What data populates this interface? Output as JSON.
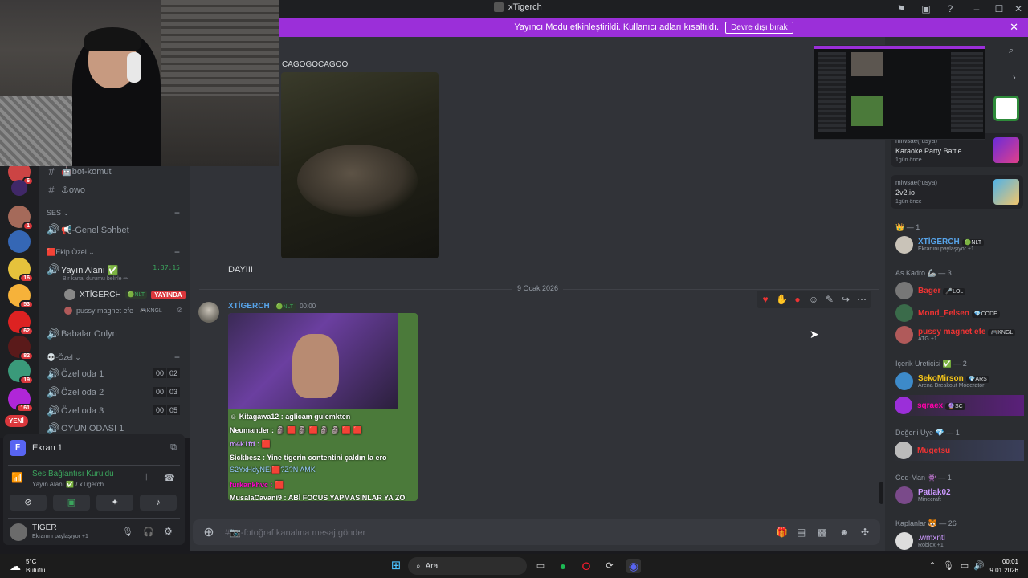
{
  "window": {
    "title": "xTigerch"
  },
  "banner": {
    "text": "Yayıncı Modu etkinleştirildi. Kullanıcı adları kısaltıldı.",
    "button": "Devre dışı bırak"
  },
  "servers": [
    {
      "badge": "6"
    },
    {
      "badge": ""
    },
    {
      "badge": "1"
    },
    {
      "badge": ""
    },
    {
      "badge": "16"
    },
    {
      "badge": "53"
    },
    {
      "badge": "62"
    },
    {
      "badge": "82"
    },
    {
      "badge": "19"
    },
    {
      "badge": "161"
    }
  ],
  "server_new": "YENİ",
  "channels": {
    "text": [
      {
        "name": "🤖bot-komut"
      },
      {
        "name": "⚓owo"
      }
    ],
    "voice_category": "SES",
    "voice": [
      {
        "name": "📢-Genel Sohbet"
      }
    ],
    "ekip_category": "🟥Ekip Özel",
    "stream_channel": {
      "name": "Yayın Alanı ✅",
      "time": "1:37:15",
      "status": "Bir kanal durumu belirle ✏"
    },
    "stream_users": [
      {
        "name": "XTİGERCH",
        "tag": "🟢NLT",
        "live": "YAYINDA"
      },
      {
        "name": "pussy magnet efe",
        "tag": "🎮KNGL"
      }
    ],
    "babalar": "Babalar Onlyn",
    "ozel_category": "💀-Özel",
    "ozel_rooms": [
      {
        "name": "Özel oda 1",
        "a": "00",
        "b": "02"
      },
      {
        "name": "Özel oda 2",
        "a": "00",
        "b": "03"
      },
      {
        "name": "Özel oda 3",
        "a": "00",
        "b": "05"
      },
      {
        "name": "OYUN ODASI 1",
        "a": "",
        "b": ""
      }
    ]
  },
  "screen_panel": {
    "title": "Ekran 1",
    "icon_letter": "F",
    "conn_status": "Ses Bağlantısı Kuruldu",
    "conn_sub": "Yayın Alanı ✅ / xTigerch",
    "user": "TIGER",
    "user_status": "Ekranını paylaşıyor +1"
  },
  "chat": {
    "msg1_name": "CAGOGOCAGOO",
    "msg1_text": "DAYIII",
    "date_divider": "9 Ocak 2026",
    "msg2_name": "XTİGERCH",
    "msg2_tag": "🟢NLT",
    "msg2_time": "00:00",
    "stream_chat": [
      "☺ Kitagawa12 : aglicam gulemkten",
      "Neumander : 🗿 🟥 🗿 🟥 🗿 🗿 🟥 🟥",
      "m4k1fd : 🟥",
      "Sickbesz : Yine tigerin contentini çaldın la ero",
      "S2YxHdyNEl🟥?Z?N AMK",
      "furkankhvc : 🟥",
      "MusalaCavani9 : ABİ FOCUS YAPMASINLAR YA ZO"
    ],
    "composer_placeholder": "#📷-fotoğraf kanalına mesaj gönder"
  },
  "activities": [
    {
      "name": "miwsae(rusya)",
      "title": "Karaoke Party Battle",
      "sub": "1gün önce"
    },
    {
      "name": "miwsae(rusya)",
      "title": "2v2.io",
      "sub": "1gün önce"
    }
  ],
  "members": {
    "cat1": "👑 — 1",
    "m1": {
      "name": "XTİGERCH",
      "tag": "🟢NLT",
      "sub": "Ekranını paylaşıyor +1"
    },
    "cat2": "As Kadro 🦾 — 3",
    "m2": {
      "name": "Bager",
      "tag": "🎤LOL"
    },
    "m3": {
      "name": "Mond_Felsen",
      "tag": "💎CODE"
    },
    "m4": {
      "name": "pussy magnet efe",
      "tag": "🎮KNGL",
      "sub": "ATG +1"
    },
    "cat3": "İçerik Üreticisi ✅ — 2",
    "m5": {
      "name": "SekoMirson",
      "tag": "💎ARS",
      "sub": "Arena Breakout Moderator"
    },
    "m6": {
      "name": "sqraex",
      "tag": "🔮SC"
    },
    "cat4": "Değerli Üye 💎 — 1",
    "m7": {
      "name": "Mugetsu"
    },
    "cat5": "Cod-Man 👾 — 1",
    "m8": {
      "name": "Patlak02",
      "sub": "Minecraft"
    },
    "cat6": "Kaplanlar 🐯 — 26",
    "m9": {
      "name": ".wmxntl",
      "sub": "Roblox +1"
    }
  },
  "taskbar": {
    "weather_temp": "5°C",
    "weather_desc": "Bulutlu",
    "search": "Ara",
    "time": "00:01",
    "date": "9.01.2026"
  }
}
